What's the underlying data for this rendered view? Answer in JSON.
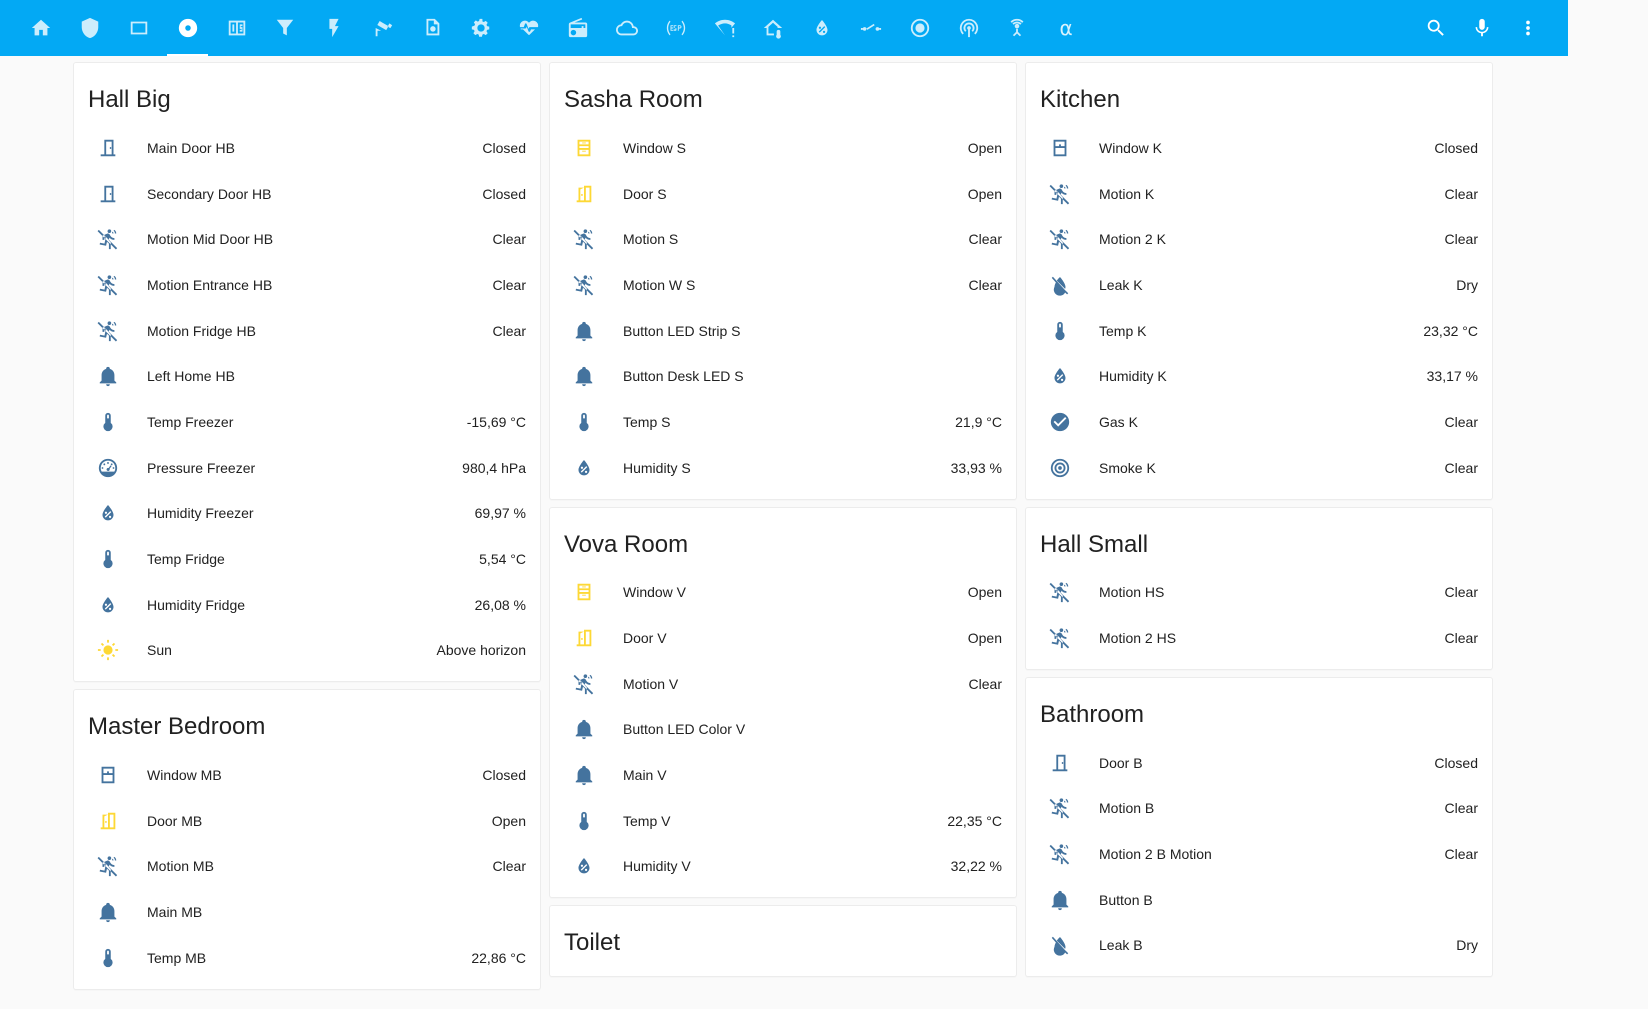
{
  "colors": {
    "header": "#03a9f4",
    "icon_default": "#44739e",
    "icon_active": "#fdd835"
  },
  "header": {
    "tabs": [
      {
        "icon": "home-icon"
      },
      {
        "icon": "shield-icon"
      },
      {
        "icon": "tablet-icon"
      },
      {
        "icon": "disc-icon",
        "active": true
      },
      {
        "icon": "numeric-icon"
      },
      {
        "icon": "filter-icon"
      },
      {
        "icon": "flash-icon"
      },
      {
        "icon": "cctv-icon"
      },
      {
        "icon": "camera-settings-icon"
      },
      {
        "icon": "gear-icon"
      },
      {
        "icon": "heart-pulse-icon"
      },
      {
        "icon": "radio-icon"
      },
      {
        "icon": "cloud-icon"
      },
      {
        "icon": "esp-icon"
      },
      {
        "icon": "wifi-alert-icon"
      },
      {
        "icon": "home-thermometer-icon"
      },
      {
        "icon": "water-percent-icon"
      },
      {
        "icon": "switch-icon"
      },
      {
        "icon": "radiobox-icon"
      },
      {
        "icon": "access-point-icon"
      },
      {
        "icon": "antenna-icon"
      },
      {
        "icon": "alpha-icon",
        "glyph": "α"
      }
    ],
    "actions": [
      {
        "icon": "search-icon"
      },
      {
        "icon": "microphone-icon"
      },
      {
        "icon": "more-vert-icon"
      }
    ]
  },
  "cards": {
    "hall_big": {
      "title": "Hall Big",
      "rows": [
        {
          "icon": "door-closed",
          "name": "Main Door HB",
          "state": "Closed"
        },
        {
          "icon": "door-closed",
          "name": "Secondary Door HB",
          "state": "Closed"
        },
        {
          "icon": "motion",
          "name": "Motion Mid Door HB",
          "state": "Clear"
        },
        {
          "icon": "motion",
          "name": "Motion Entrance HB",
          "state": "Clear"
        },
        {
          "icon": "motion",
          "name": "Motion Fridge HB",
          "state": "Clear"
        },
        {
          "icon": "bell",
          "name": "Left Home HB",
          "state": ""
        },
        {
          "icon": "thermometer",
          "name": "Temp Freezer",
          "state": "-15,69 °C"
        },
        {
          "icon": "gauge",
          "name": "Pressure Freezer",
          "state": "980,4 hPa"
        },
        {
          "icon": "water-percent",
          "name": "Humidity Freezer",
          "state": "69,97 %"
        },
        {
          "icon": "thermometer",
          "name": "Temp Fridge",
          "state": "5,54 °C"
        },
        {
          "icon": "water-percent",
          "name": "Humidity Fridge",
          "state": "26,08 %"
        },
        {
          "icon": "sun",
          "name": "Sun",
          "state": "Above horizon"
        }
      ]
    },
    "master_bedroom": {
      "title": "Master Bedroom",
      "rows": [
        {
          "icon": "window-closed",
          "name": "Window MB",
          "state": "Closed"
        },
        {
          "icon": "door-open",
          "name": "Door MB",
          "state": "Open"
        },
        {
          "icon": "motion",
          "name": "Motion MB",
          "state": "Clear"
        },
        {
          "icon": "bell",
          "name": "Main MB",
          "state": ""
        },
        {
          "icon": "thermometer",
          "name": "Temp MB",
          "state": "22,86 °C"
        }
      ]
    },
    "sasha_room": {
      "title": "Sasha Room",
      "rows": [
        {
          "icon": "window-open",
          "name": "Window S",
          "state": "Open"
        },
        {
          "icon": "door-open",
          "name": "Door S",
          "state": "Open"
        },
        {
          "icon": "motion",
          "name": "Motion S",
          "state": "Clear"
        },
        {
          "icon": "motion",
          "name": "Motion W S",
          "state": "Clear"
        },
        {
          "icon": "bell",
          "name": "Button LED Strip S",
          "state": ""
        },
        {
          "icon": "bell",
          "name": "Button Desk LED S",
          "state": ""
        },
        {
          "icon": "thermometer",
          "name": "Temp S",
          "state": "21,9 °C"
        },
        {
          "icon": "water-percent",
          "name": "Humidity S",
          "state": "33,93 %"
        }
      ]
    },
    "vova_room": {
      "title": "Vova Room",
      "rows": [
        {
          "icon": "window-open",
          "name": "Window V",
          "state": "Open"
        },
        {
          "icon": "door-open",
          "name": "Door V",
          "state": "Open"
        },
        {
          "icon": "motion",
          "name": "Motion V",
          "state": "Clear"
        },
        {
          "icon": "bell",
          "name": "Button LED Color V",
          "state": ""
        },
        {
          "icon": "bell",
          "name": "Main V",
          "state": ""
        },
        {
          "icon": "thermometer",
          "name": "Temp V",
          "state": "22,35 °C"
        },
        {
          "icon": "water-percent",
          "name": "Humidity V",
          "state": "32,22 %"
        }
      ]
    },
    "toilet": {
      "title": "Toilet",
      "rows": []
    },
    "kitchen": {
      "title": "Kitchen",
      "rows": [
        {
          "icon": "window-closed",
          "name": "Window K",
          "state": "Closed"
        },
        {
          "icon": "motion",
          "name": "Motion K",
          "state": "Clear"
        },
        {
          "icon": "motion",
          "name": "Motion 2 K",
          "state": "Clear"
        },
        {
          "icon": "water-off",
          "name": "Leak K",
          "state": "Dry"
        },
        {
          "icon": "thermometer",
          "name": "Temp K",
          "state": "23,32 °C"
        },
        {
          "icon": "water-percent",
          "name": "Humidity K",
          "state": "33,17 %"
        },
        {
          "icon": "check-circle",
          "name": "Gas K",
          "state": "Clear"
        },
        {
          "icon": "smoke-detector",
          "name": "Smoke K",
          "state": "Clear"
        }
      ]
    },
    "hall_small": {
      "title": "Hall Small",
      "rows": [
        {
          "icon": "motion",
          "name": "Motion HS",
          "state": "Clear"
        },
        {
          "icon": "motion",
          "name": "Motion 2 HS",
          "state": "Clear"
        }
      ]
    },
    "bathroom": {
      "title": "Bathroom",
      "rows": [
        {
          "icon": "door-closed",
          "name": "Door B",
          "state": "Closed"
        },
        {
          "icon": "motion",
          "name": "Motion B",
          "state": "Clear"
        },
        {
          "icon": "motion",
          "name": "Motion 2 B Motion",
          "state": "Clear"
        },
        {
          "icon": "bell",
          "name": "Button B",
          "state": ""
        },
        {
          "icon": "water-off",
          "name": "Leak B",
          "state": "Dry"
        }
      ]
    }
  }
}
